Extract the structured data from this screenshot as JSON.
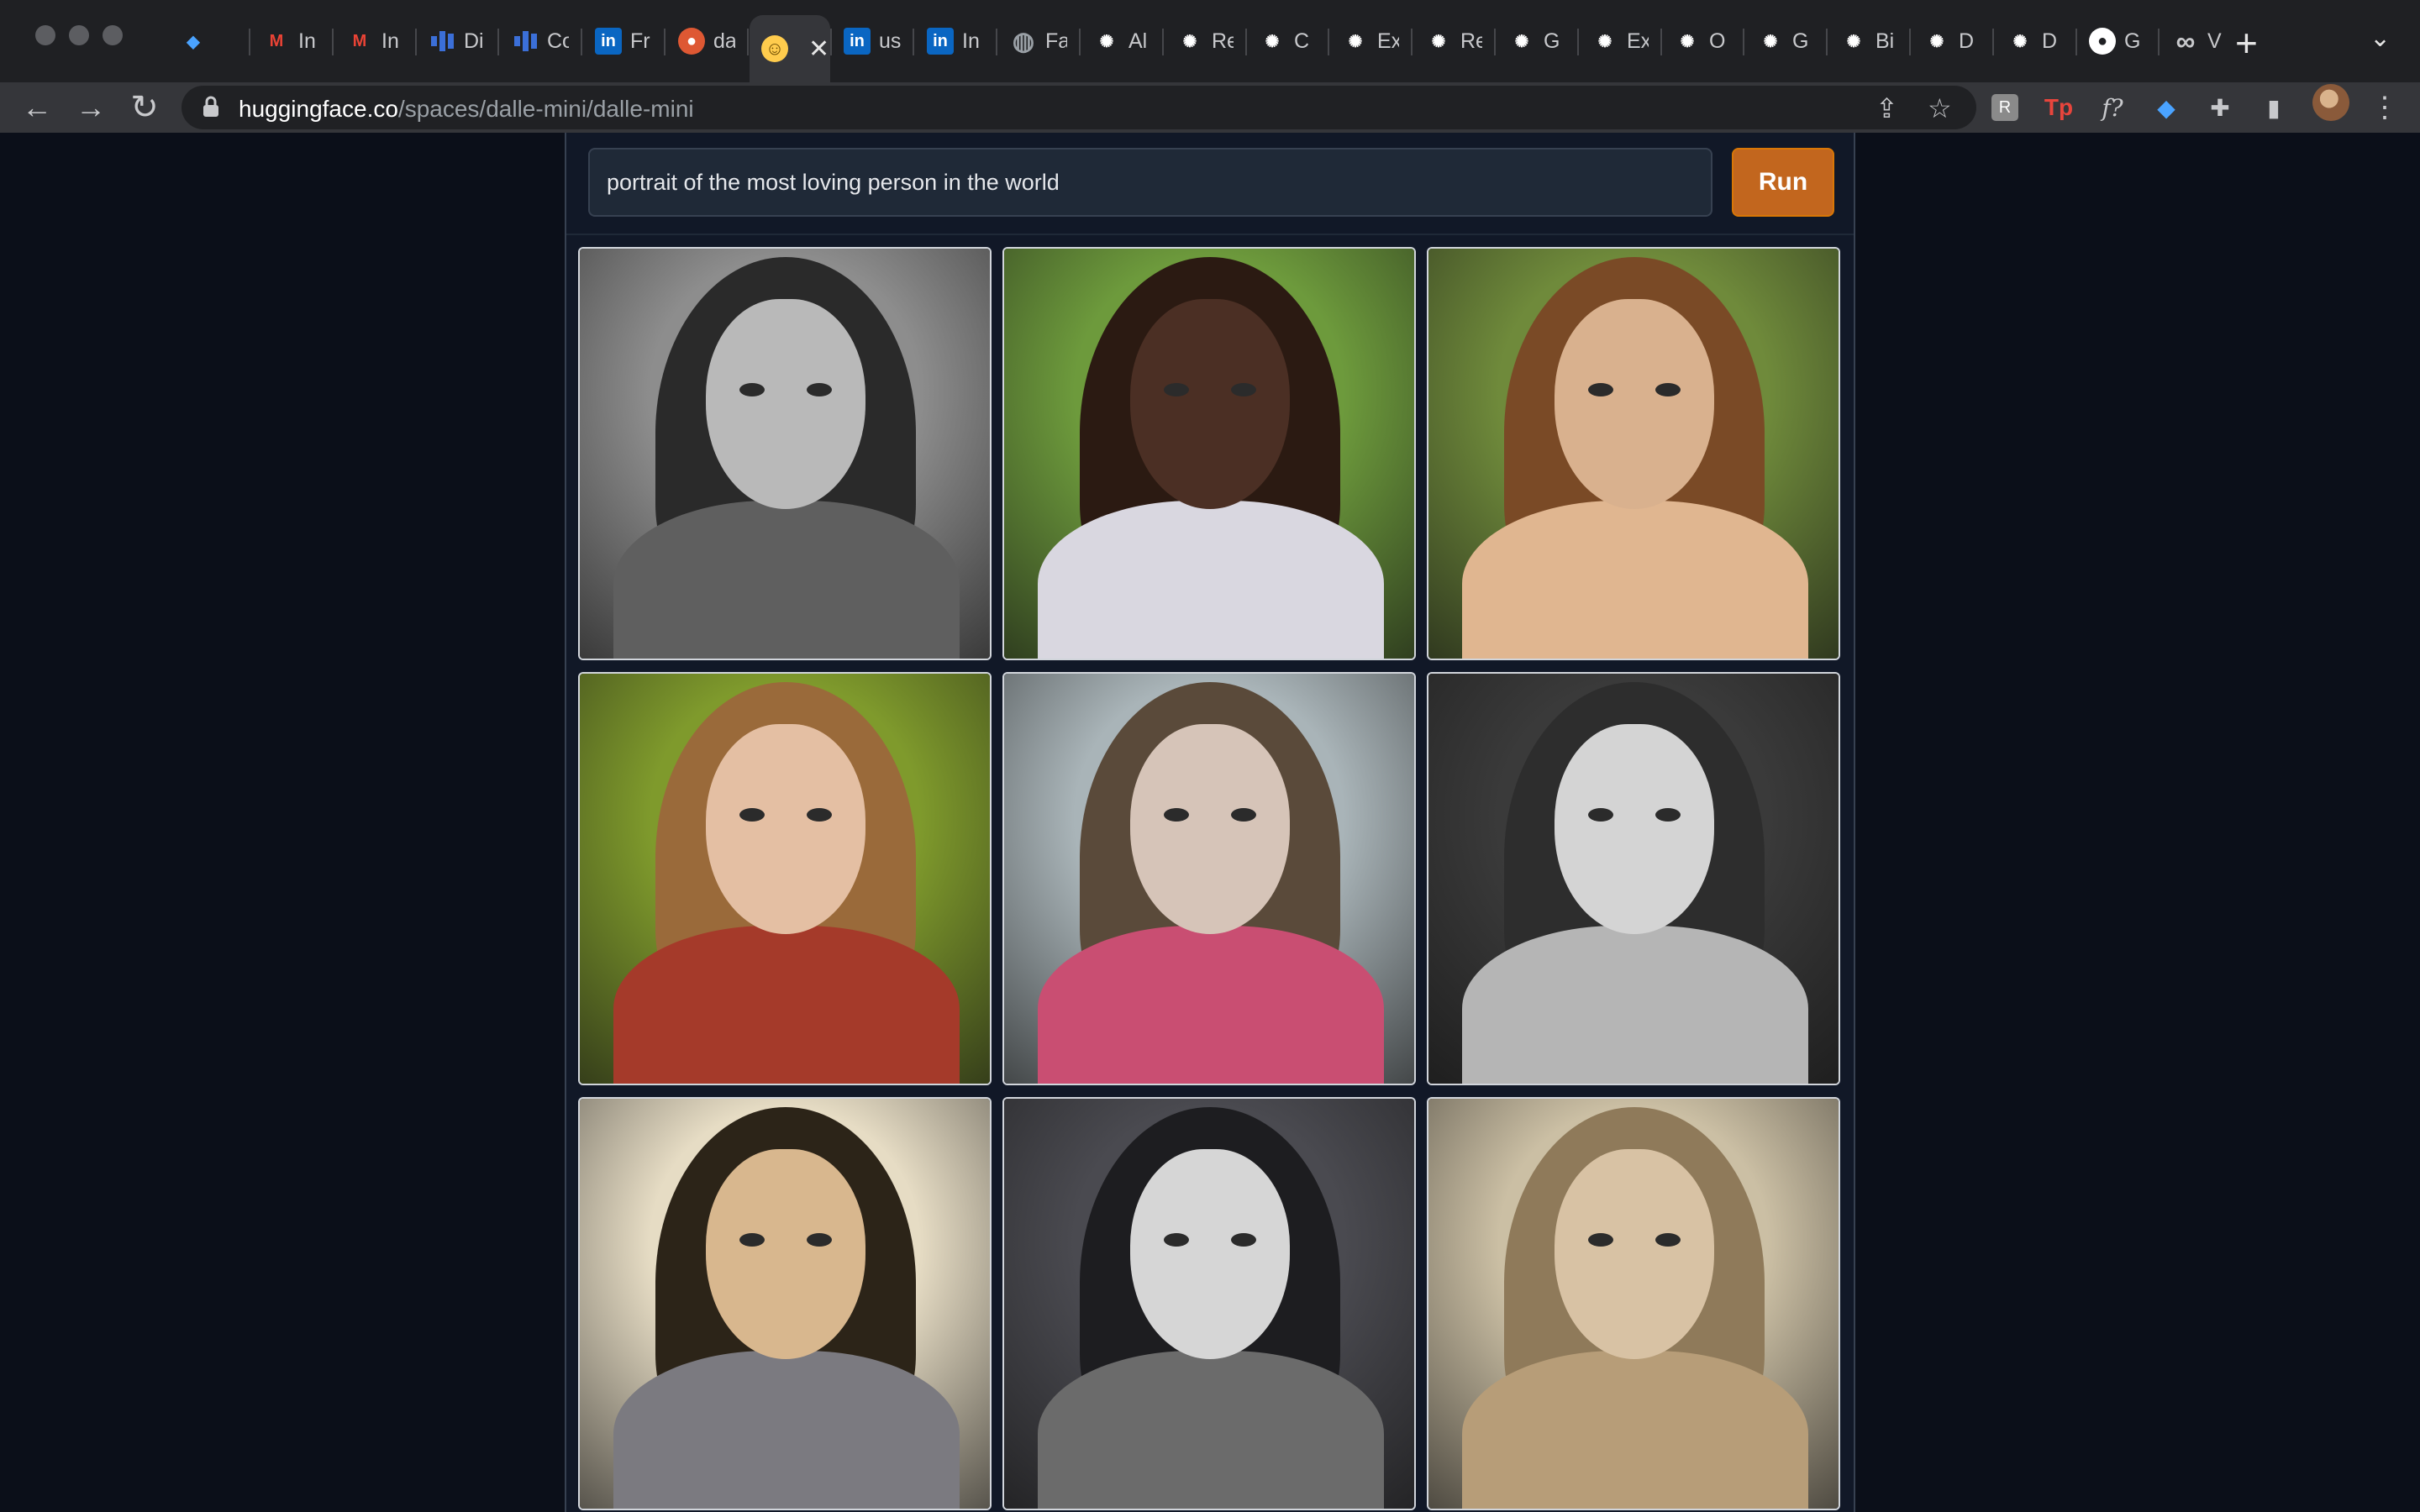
{
  "browser": {
    "tabs": [
      {
        "favicon": "sketch-gem-icon",
        "title": ""
      },
      {
        "favicon": "gmail-icon",
        "title": "In"
      },
      {
        "favicon": "gmail-icon",
        "title": "In"
      },
      {
        "favicon": "bar-chart-icon",
        "title": "Di"
      },
      {
        "favicon": "bar-chart-icon",
        "title": "Co"
      },
      {
        "favicon": "linkedin-icon",
        "title": "Fr"
      },
      {
        "favicon": "duckduckgo-icon",
        "title": "da"
      },
      {
        "favicon": "hugging-face-icon",
        "title": "",
        "active": true
      },
      {
        "favicon": "linkedin-icon",
        "title": "us"
      },
      {
        "favicon": "linkedin-icon",
        "title": "In"
      },
      {
        "favicon": "globe-icon",
        "title": "Fa"
      },
      {
        "favicon": "openai-icon",
        "title": "Al"
      },
      {
        "favicon": "openai-icon",
        "title": "Re"
      },
      {
        "favicon": "openai-icon",
        "title": "C"
      },
      {
        "favicon": "openai-icon",
        "title": "Ex"
      },
      {
        "favicon": "openai-icon",
        "title": "Re"
      },
      {
        "favicon": "openai-icon",
        "title": "G"
      },
      {
        "favicon": "openai-icon",
        "title": "Ex"
      },
      {
        "favicon": "openai-icon",
        "title": "O"
      },
      {
        "favicon": "openai-icon",
        "title": "G"
      },
      {
        "favicon": "openai-icon",
        "title": "Bi"
      },
      {
        "favicon": "openai-icon",
        "title": "D"
      },
      {
        "favicon": "openai-icon",
        "title": "D"
      },
      {
        "favicon": "github-icon",
        "title": "G"
      },
      {
        "favicon": "infinity-icon",
        "title": "V"
      }
    ],
    "address": {
      "host": "huggingface.co",
      "path": "/spaces/dalle-mini/dalle-mini"
    },
    "extensions": [
      "readwise-icon",
      "tp-icon",
      "fx-icon",
      "gem-icon",
      "puzzle-icon",
      "sidebar-icon"
    ]
  },
  "app": {
    "prompt": "portrait of the most loving person in the world",
    "run_label": "Run",
    "colors": {
      "run": "#c2661e",
      "panel": "#111827",
      "page": "#0b0f19"
    },
    "images": [
      {
        "bg": "#8d8d8d",
        "hair": "#2a2a2a",
        "face": "#b9b9b9",
        "body": "#5f5f5f"
      },
      {
        "bg": "#6d9a3c",
        "hair": "#2b1a12",
        "face": "#4b2f24",
        "body": "#d9d7e0"
      },
      {
        "bg": "#6f8a3b",
        "hair": "#7a4a26",
        "face": "#d9b18e",
        "body": "#e0b690"
      },
      {
        "bg": "#7f9a2c",
        "hair": "#9a6a3a",
        "face": "#e4bfa3",
        "body": "#a53a2a"
      },
      {
        "bg": "#a9b4b8",
        "hair": "#5a4a3a",
        "face": "#d6c4b8",
        "body": "#c94e72"
      },
      {
        "bg": "#3a3a3a",
        "hair": "#2d2d2d",
        "face": "#d4d4d4",
        "body": "#b5b5b5"
      },
      {
        "bg": "#e6dcc4",
        "hair": "#2c2418",
        "face": "#d8b78e",
        "body": "#7b7a80"
      },
      {
        "bg": "#4a4a50",
        "hair": "#1d1d20",
        "face": "#d6d6d6",
        "body": "#6b6b6b"
      },
      {
        "bg": "#cbbfa4",
        "hair": "#8f7a5a",
        "face": "#d8c2a4",
        "body": "#b79d78"
      }
    ]
  }
}
